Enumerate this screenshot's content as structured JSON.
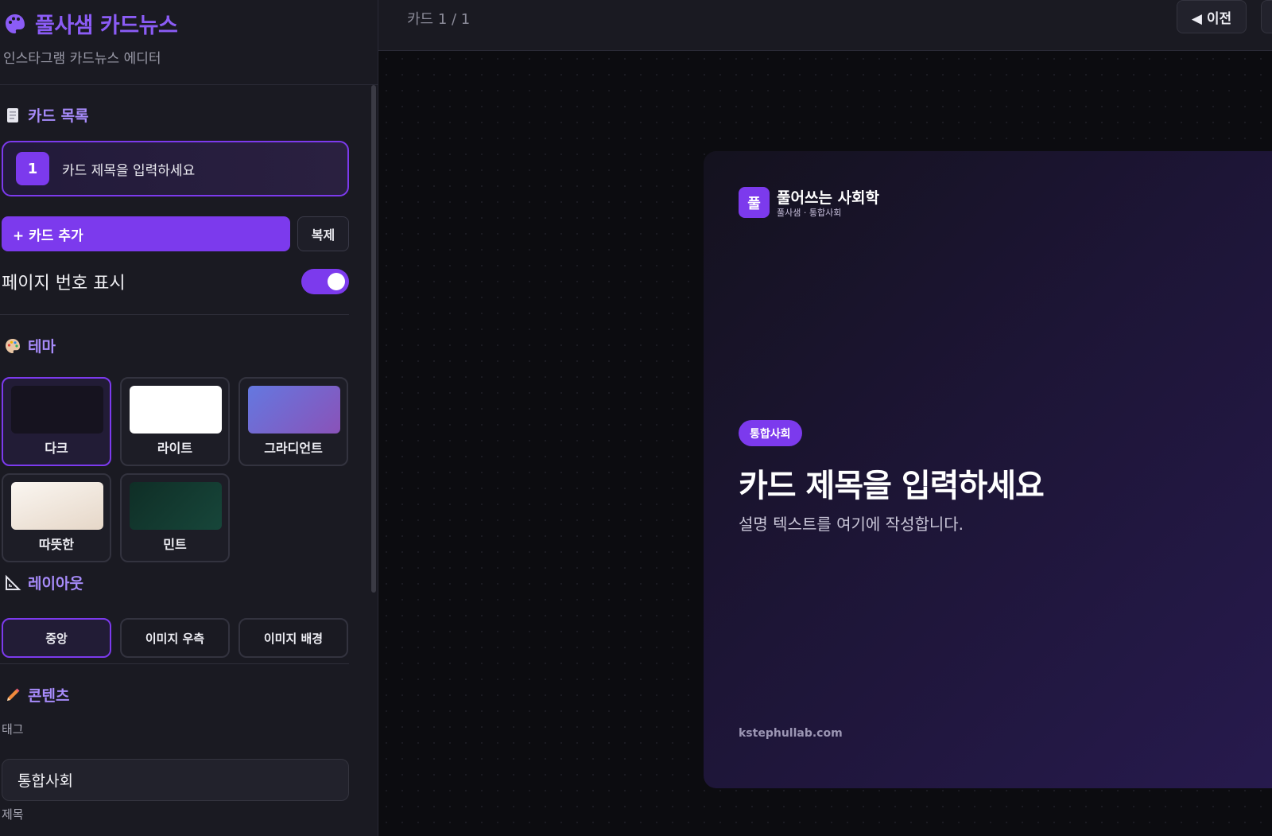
{
  "app": {
    "title": "풀사샘 카드뉴스",
    "subtitle": "인스타그램 카드뉴스 에디터"
  },
  "sidebar": {
    "card_list": {
      "title": "카드 목록",
      "items": [
        {
          "number": "1",
          "label": "카드 제목을 입력하세요"
        }
      ],
      "add_label": "+ 카드 추가",
      "duplicate_label": "복제",
      "page_number_label": "페이지 번호 표시",
      "page_number_enabled": true
    },
    "theme": {
      "title": "테마",
      "options": [
        {
          "name": "다크",
          "selected": true,
          "swatch": "#16131f"
        },
        {
          "name": "라이트",
          "selected": false,
          "swatch": "#ffffff"
        },
        {
          "name": "그라디언트",
          "selected": false,
          "swatch": "#6b6fd8"
        },
        {
          "name": "따뜻한",
          "selected": false,
          "swatch": "#f3ebe2"
        },
        {
          "name": "민트",
          "selected": false,
          "swatch": "#123a30"
        }
      ]
    },
    "layout": {
      "title": "레이아웃",
      "options": [
        "중앙",
        "이미지 우측",
        "이미지 배경"
      ],
      "selected": "중앙"
    },
    "content": {
      "title": "콘텐츠",
      "tag_label": "태그",
      "tag_value": "통합사회",
      "title_label": "제목"
    }
  },
  "topbar": {
    "counter": "카드 1 / 1",
    "prev_label": "◀ 이전"
  },
  "card": {
    "logo_char": "풀",
    "brand": "풀어쓰는 사회학",
    "brand_sub": "풀사샘 · 통합사회",
    "tag": "통합사회",
    "title": "카드 제목을 입력하세요",
    "description": "설명 텍스트를 여기에 작성합니다.",
    "footer": "kstephullab.com"
  },
  "colors": {
    "accent": "#7c3aed",
    "accent_text": "#a78bfa"
  }
}
